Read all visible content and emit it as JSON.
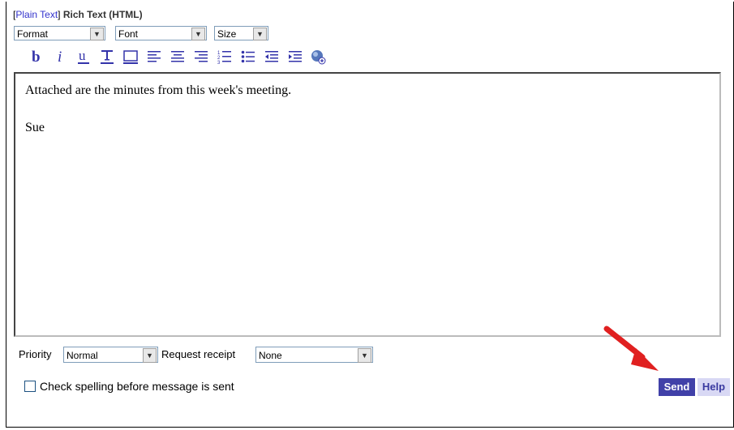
{
  "mode": {
    "bracket_open": "[",
    "plain_text": "Plain Text",
    "bracket_close": "]",
    "rich_text": "Rich Text (HTML)"
  },
  "format_bar": {
    "format": "Format",
    "font": "Font",
    "size": "Size"
  },
  "toolbar_icons": [
    "bold-icon",
    "italic-icon",
    "underline-icon",
    "text-color-icon",
    "highlight-icon",
    "align-left-icon",
    "align-center-icon",
    "align-right-icon",
    "numbered-list-icon",
    "bullet-list-icon",
    "outdent-icon",
    "indent-icon",
    "insert-image-icon"
  ],
  "editor": {
    "line1": "Attached are the minutes from this week's meeting.",
    "line2": "Sue"
  },
  "options": {
    "priority_label": "Priority",
    "priority_value": "Normal",
    "receipt_label": "Request receipt",
    "receipt_value": "None"
  },
  "spell_check_label": "Check spelling before message is sent",
  "send_label": "Send",
  "help_label": "Help",
  "colors": {
    "accent": "#4040a8",
    "link": "#3333cc",
    "arrow": "#e02020"
  }
}
